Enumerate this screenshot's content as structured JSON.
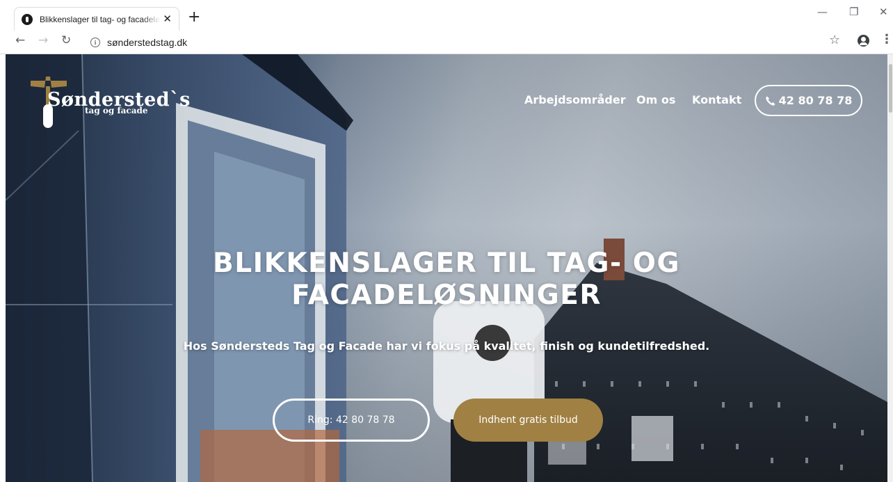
{
  "browser": {
    "tab_title": "Blikkenslager til tag- og facadeløsninger",
    "tab_close": "✕",
    "new_tab": "+",
    "url": "sønderstedstag.dk",
    "icons": {
      "back": "arrow-left-icon",
      "forward": "arrow-right-icon",
      "reload": "reload-icon",
      "info": "info-icon",
      "bookmark": "star-icon",
      "profile": "profile-icon",
      "menu": "kebab-menu-icon"
    }
  },
  "site": {
    "logo": {
      "name": "Søndersted`s",
      "subtitle": "tag og facade"
    },
    "nav": {
      "items": [
        "Arbejdsområder",
        "Om os",
        "Kontakt"
      ],
      "phone": "42 80 78 78"
    },
    "hero": {
      "title_line1": "BLIKKENSLAGER TIL TAG- OG",
      "title_line2": "FACADELØSNINGER",
      "subtitle": "Hos Søndersteds Tag og Facade har vi fokus på kvalitet, finish og kundetilfredshed.",
      "cta_call": "Ring: 42 80 78 78",
      "cta_quote": "Indhent gratis tilbud"
    }
  },
  "colors": {
    "accent_gold": "#a08143",
    "nav_text": "#ffffff",
    "chrome_bg": "#ffffff"
  }
}
